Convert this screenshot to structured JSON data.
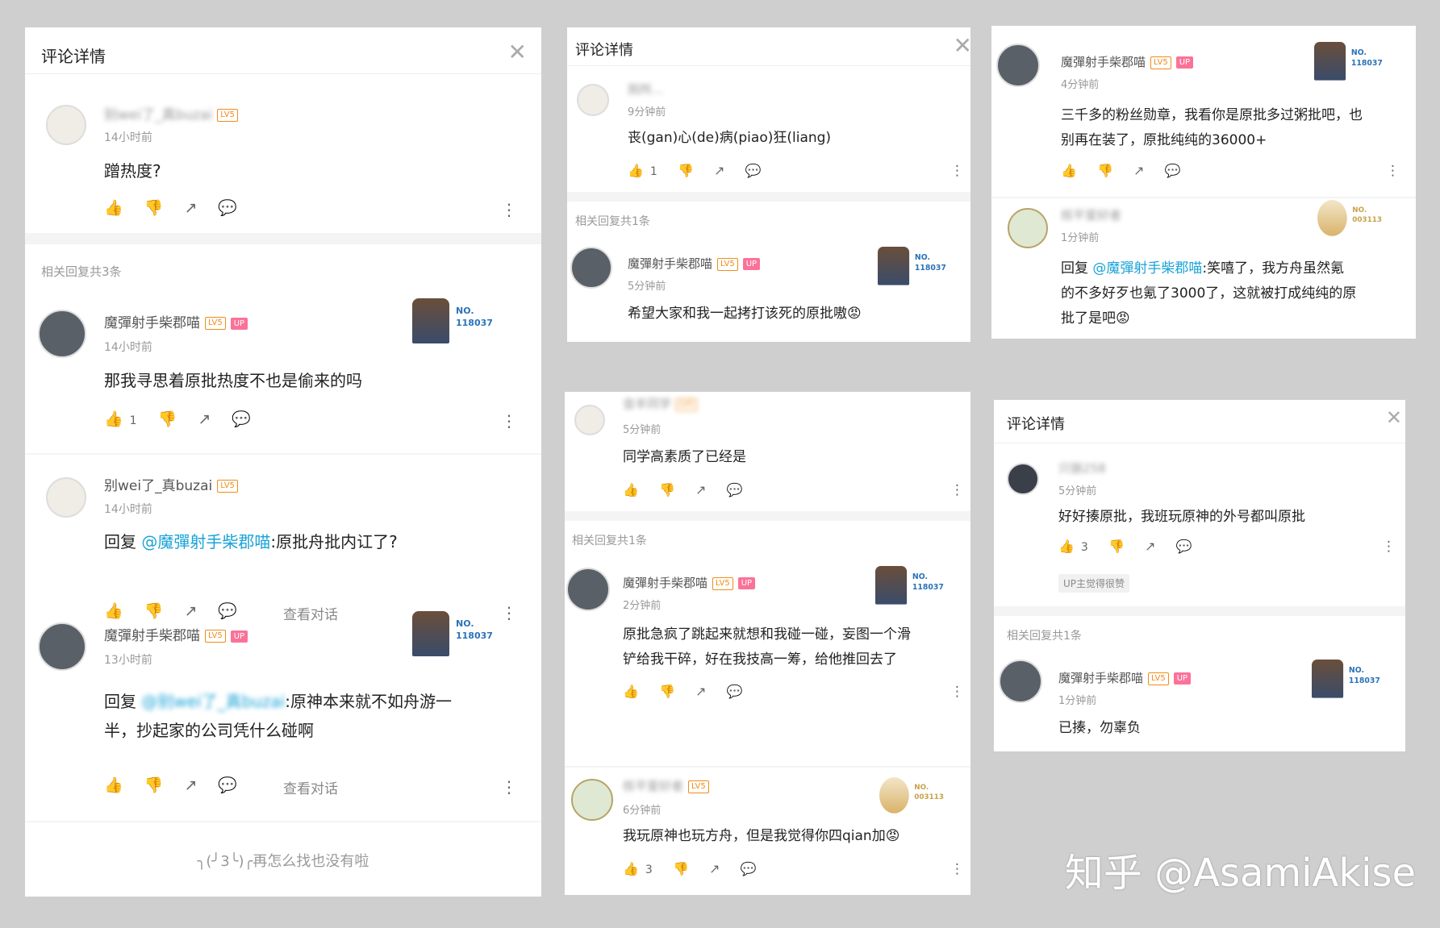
{
  "header_title": "评论详情",
  "close_glyph": "✕",
  "lv5": "LV5",
  "up": "UP",
  "more_glyph": "⋮",
  "badge_no1": "NO.",
  "badge_num1": "118037",
  "badge_num2": "003113",
  "view_convo": "查看对话",
  "icons": {
    "like": "👍",
    "dislike": "👎",
    "share": "↗",
    "reply": "💬"
  },
  "p1": {
    "c1": {
      "name": "别wei了_真buzai",
      "time": "14小时前",
      "text": "蹭热度?"
    },
    "related": "相关回复共3条",
    "r1": {
      "name": "魔彈射手柴郡喵",
      "time": "14小时前",
      "text": "那我寻思着原批热度不也是偷来的吗",
      "likes": "1"
    },
    "r2": {
      "name": "别wei了_真buzai",
      "time": "14小时前",
      "prefix": "回复 ",
      "at": "@魔彈射手柴郡喵",
      "text": ":原批舟批内讧了?"
    },
    "r3": {
      "name": "魔彈射手柴郡喵",
      "time": "13小时前",
      "prefix": "回复 ",
      "at": "@别wei了_真buzai",
      "text1": ":原神本来就不如舟游一",
      "text2": "半，抄起家的公司凭什么碰啊"
    },
    "end": "╮(╯3╰)╭再怎么找也没有啦"
  },
  "p2": {
    "c1": {
      "name": "厕所...",
      "time": "9分钟前",
      "text": "丧(gan)心(de)病(piao)狂(liang)",
      "likes": "1"
    },
    "related": "相关回复共1条",
    "r1": {
      "name": "魔彈射手柴郡喵",
      "time": "5分钟前",
      "text": "希望大家和我一起拷打该死的原批嗷😡"
    }
  },
  "p3": {
    "c1": {
      "name": "魔彈射手柴郡喵",
      "time": "4分钟前",
      "text1": "三千多的粉丝勋章，我看你是原批多过粥批吧，也",
      "text2": "别再在装了，原批纯纯的36000+"
    },
    "c2": {
      "name": "核平爱好者",
      "time": "1分钟前",
      "prefix": "回复 ",
      "at": "@魔彈射手柴郡喵",
      "text1": ":笑嘻了，我方舟虽然氪",
      "text2": "的不多好歹也氪了3000了，这就被打成纯纯的原",
      "text3": "批了是吧😡"
    }
  },
  "p4": {
    "c1": {
      "name": "音羊同学",
      "time": "5分钟前",
      "text": "同学高素质了已经是"
    },
    "related": "相关回复共1条",
    "r1": {
      "name": "魔彈射手柴郡喵",
      "time": "2分钟前",
      "text1": "原批急疯了跳起来就想和我碰一碰，妄图一个滑",
      "text2": "铲给我干碎，好在我技高一筹，给他推回去了"
    },
    "r2": {
      "name": "核平爱好者",
      "time": "6分钟前",
      "text": "我玩原神也玩方舟，但是我觉得你四qian加😡",
      "likes": "3"
    }
  },
  "p5": {
    "c1": {
      "name": "只狼258",
      "time": "5分钟前",
      "text": "好好揍原批，我班玩原神的外号都叫原批",
      "likes": "3",
      "tag": "UP主觉得很赞"
    },
    "related": "相关回复共1条",
    "r1": {
      "name": "魔彈射手柴郡喵",
      "time": "1分钟前",
      "text": "已揍，勿辜负"
    }
  },
  "watermark": "知乎 @AsamiAkise"
}
